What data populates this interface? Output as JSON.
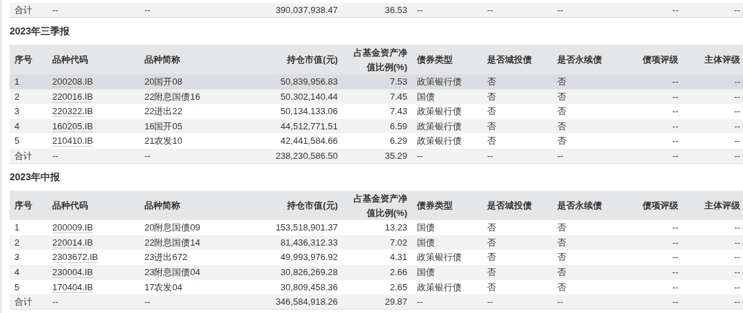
{
  "previous_table": {
    "total_row": [
      "合计",
      "--",
      "--",
      "390,037,938.47",
      "36.53",
      "--",
      "--",
      "--",
      "--",
      "--"
    ]
  },
  "sections": [
    {
      "title": "2023年三季报",
      "columns": [
        "序号",
        "品种代码",
        "品种简称",
        "持仓市值(元)",
        "占基金资产净值比例(%)",
        "债券类型",
        "是否城投债",
        "是否永续债",
        "债项评级",
        "主体评级"
      ],
      "rows": [
        {
          "highlighted": true,
          "cells": [
            "1",
            "200208.IB",
            "20国开08",
            "50,839,956.83",
            "7.53",
            "政策银行债",
            "否",
            "否",
            "--",
            "--"
          ]
        },
        {
          "highlighted": false,
          "cells": [
            "2",
            "220016.IB",
            "22附息国债16",
            "50,302,140.44",
            "7.45",
            "国债",
            "否",
            "否",
            "--",
            "--"
          ]
        },
        {
          "highlighted": false,
          "cells": [
            "3",
            "220322.IB",
            "22进出22",
            "50,134,133.06",
            "7.43",
            "政策银行债",
            "否",
            "否",
            "--",
            "--"
          ]
        },
        {
          "highlighted": false,
          "cells": [
            "4",
            "160205.IB",
            "16国开05",
            "44,512,771.51",
            "6.59",
            "政策银行债",
            "否",
            "否",
            "--",
            "--"
          ]
        },
        {
          "highlighted": false,
          "cells": [
            "5",
            "210410.IB",
            "21农发10",
            "42,441,584.66",
            "6.29",
            "政策银行债",
            "否",
            "否",
            "--",
            "--"
          ]
        }
      ],
      "total_row": [
        "合计",
        "--",
        "--",
        "238,230,586.50",
        "35.29",
        "--",
        "--",
        "--",
        "--",
        "--"
      ]
    },
    {
      "title": "2023年中报",
      "columns": [
        "序号",
        "品种代码",
        "品种简称",
        "持仓市值(元)",
        "占基金资产净值比例(%)",
        "债券类型",
        "是否城投债",
        "是否永续债",
        "债项评级",
        "主体评级"
      ],
      "rows": [
        {
          "highlighted": false,
          "cells": [
            "1",
            "200009.IB",
            "20附息国债09",
            "153,518,901.37",
            "13.23",
            "国债",
            "否",
            "否",
            "--",
            "--"
          ]
        },
        {
          "highlighted": false,
          "cells": [
            "2",
            "220014.IB",
            "22附息国债14",
            "81,436,312.33",
            "7.02",
            "国债",
            "否",
            "否",
            "--",
            "--"
          ]
        },
        {
          "highlighted": false,
          "cells": [
            "3",
            "2303672.IB",
            "23进出672",
            "49,993,976.92",
            "4.31",
            "政策银行债",
            "否",
            "否",
            "--",
            "--"
          ]
        },
        {
          "highlighted": false,
          "cells": [
            "4",
            "230004.IB",
            "23附息国债04",
            "30,826,269.28",
            "2.66",
            "国债",
            "否",
            "否",
            "--",
            "--"
          ]
        },
        {
          "highlighted": false,
          "cells": [
            "5",
            "170404.IB",
            "17农发04",
            "30,809,458.36",
            "2.65",
            "政策银行债",
            "否",
            "否",
            "--",
            "--"
          ]
        }
      ],
      "total_row": [
        "合计",
        "--",
        "--",
        "346,584,918.26",
        "29.87",
        "--",
        "--",
        "--",
        "--",
        "--"
      ]
    }
  ]
}
